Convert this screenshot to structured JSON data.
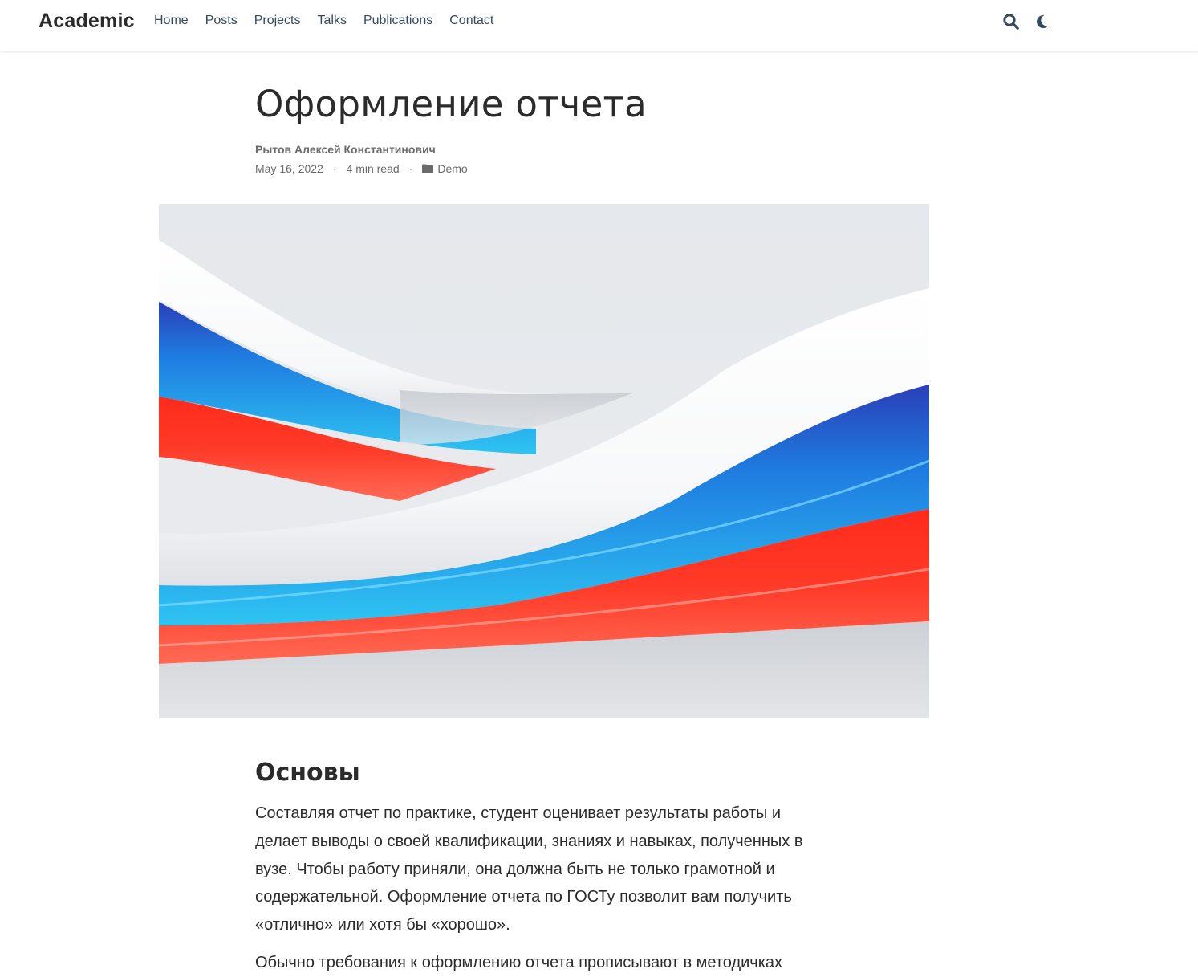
{
  "navbar": {
    "brand": "Academic",
    "links": [
      "Home",
      "Posts",
      "Projects",
      "Talks",
      "Publications",
      "Contact"
    ],
    "search_icon": "search-icon",
    "theme_icon": "moon-icon"
  },
  "article": {
    "title": "Оформление отчета",
    "author": "Рытов Алексей Константинович",
    "date": "May 16, 2022",
    "separator": "·",
    "read_time": "4 min read",
    "category": "Demo",
    "category_icon": "folder-icon",
    "hero_image": "russian-flag-ribbon-image",
    "section_heading": "Основы",
    "paragraph_1": "Составляя отчет по практике, студент оценивает результаты работы и делает выводы о своей квалификации, знаниях и навыках, полученных в вузе. Чтобы работу приняли, она должна быть не только грамотной и содержательной. Оформление отчета по ГОСТу позволит вам получить «отлично» или хотя бы «хорошо».",
    "paragraph_2": "Обычно требования к оформлению отчета прописывают в методичках"
  },
  "colors": {
    "brand_text": "#2b2b2b",
    "nav_text": "#34495e",
    "muted_text": "#6b6b6b",
    "flag_white": "#ffffff",
    "flag_blue": "#1e90e6",
    "flag_red": "#ff2a1a"
  }
}
